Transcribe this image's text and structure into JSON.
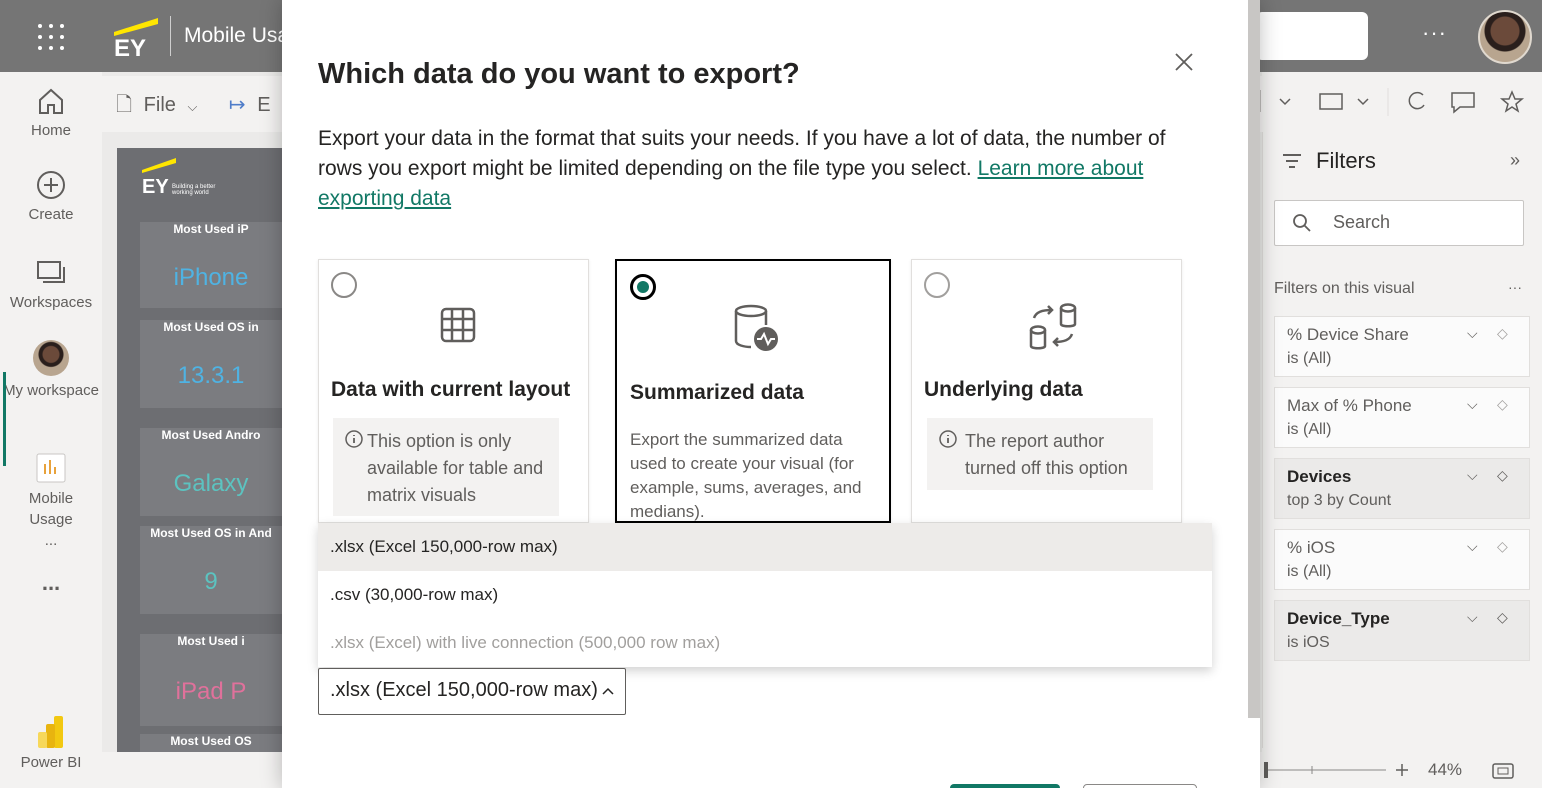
{
  "topbar": {
    "app_title": "Mobile Usa",
    "more": "···"
  },
  "nav": {
    "home": "Home",
    "create": "Create",
    "workspaces": "Workspaces",
    "my_workspace": "My workspace",
    "mobile_usage": "Mobile Usage ...",
    "more": "...",
    "power_bi": "Power BI"
  },
  "toolbar": {
    "file": "File",
    "export_partial": "E"
  },
  "report": {
    "cards": [
      {
        "title": "Most Used iP",
        "value": "iPhone",
        "color": "#4fb3e3"
      },
      {
        "title": "Most Used OS in",
        "value": "13.3.1",
        "color": "#4fb3e3"
      },
      {
        "title": "Most Used Andro",
        "value": "Galaxy",
        "color": "#5cc3c0"
      },
      {
        "title": "Most Used OS in And",
        "value": "9",
        "color": "#5cc3c0"
      },
      {
        "title": "Most Used i",
        "value": "iPad P",
        "color": "#e0719b"
      },
      {
        "title": "Most Used OS",
        "value": "",
        "color": "#e0719b"
      }
    ]
  },
  "filters": {
    "title": "Filters",
    "search_placeholder": "Search",
    "section": "Filters on this visual",
    "items": [
      {
        "name": "% Device Share",
        "value": "is (All)",
        "active": false
      },
      {
        "name": "Max of % Phone",
        "value": "is (All)",
        "active": false
      },
      {
        "name": "Devices",
        "value": "top 3 by Count",
        "active": true
      },
      {
        "name": "% iOS",
        "value": "is (All)",
        "active": false
      },
      {
        "name": "Device_Type",
        "value": "is iOS",
        "active": true
      }
    ]
  },
  "zoom": {
    "level": "44%"
  },
  "dialog": {
    "title": "Which data do you want to export?",
    "description": "Export your data in the format that suits your needs. If you have a lot of data, the number of rows you export might be limited depending on the file type you select.",
    "link_text": "Learn more about exporting data",
    "options": [
      {
        "title": "Data with current layout",
        "note": "This option is only available for table and matrix visuals",
        "selected": false
      },
      {
        "title": "Summarized data",
        "desc": "Export the summarized data used to create your visual (for example, sums, averages, and medians).",
        "selected": true
      },
      {
        "title": "Underlying data",
        "note": "The report author turned off this option",
        "selected": false
      }
    ],
    "format_options": [
      ".xlsx (Excel 150,000-row max)",
      ".csv (30,000-row max)",
      ".xlsx (Excel) with live connection (500,000 row max)"
    ],
    "selected_format": ".xlsx (Excel 150,000-row max)"
  },
  "colors": {
    "accent": "#117865",
    "topbar": "#757575"
  }
}
